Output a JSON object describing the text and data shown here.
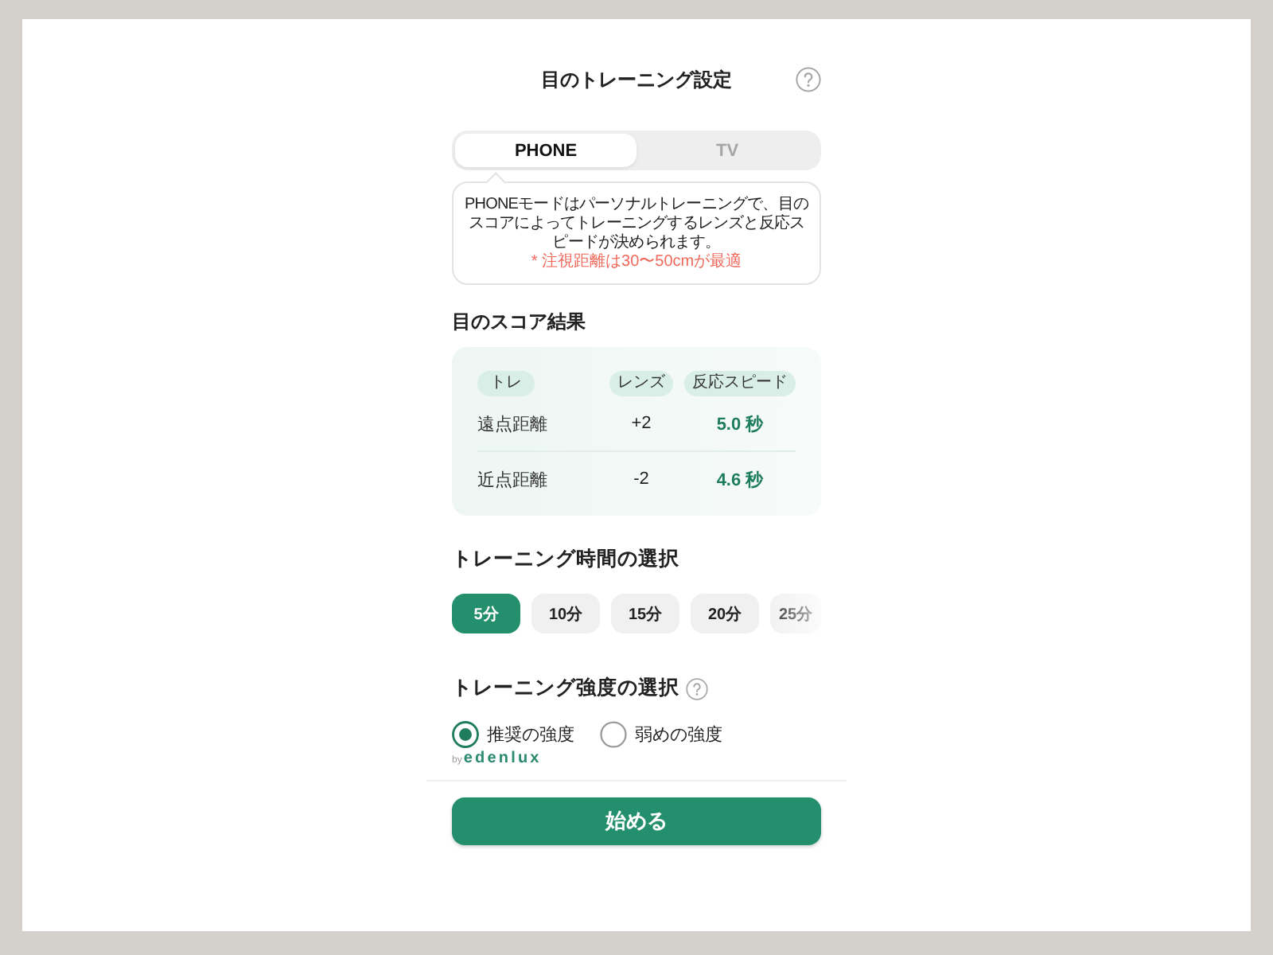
{
  "header": {
    "title": "目のトレーニング設定"
  },
  "mode_tabs": [
    {
      "label": "PHONE",
      "selected": true
    },
    {
      "label": "TV",
      "selected": false
    }
  ],
  "mode_info": {
    "text": "PHONEモードはパーソナルトレーニングで、目のスコアによってトレーニングするレンズと反応スピードが決められます。",
    "note": "* 注視距離は30〜50cmが最適"
  },
  "score_section": {
    "title": "目のスコア結果",
    "columns": [
      "トレ",
      "レンズ",
      "反応スピード"
    ],
    "rows": [
      {
        "name": "遠点距離",
        "lens": "+2",
        "speed": "5.0 秒"
      },
      {
        "name": "近点距離",
        "lens": "-2",
        "speed": "4.6 秒"
      }
    ]
  },
  "duration_section": {
    "title": "トレーニング時間の選択",
    "options": [
      {
        "label": "5分",
        "selected": true
      },
      {
        "label": "10分",
        "selected": false
      },
      {
        "label": "15分",
        "selected": false
      },
      {
        "label": "20分",
        "selected": false
      },
      {
        "label": "25分",
        "selected": false
      }
    ]
  },
  "intensity_section": {
    "title": "トレーニング強度の選択",
    "options": [
      {
        "label": "推奨の強度",
        "selected": true
      },
      {
        "label": "弱めの強度",
        "selected": false
      }
    ]
  },
  "brand": {
    "prefix": "by",
    "name": "edenlux"
  },
  "start_button": {
    "label": "始める"
  }
}
